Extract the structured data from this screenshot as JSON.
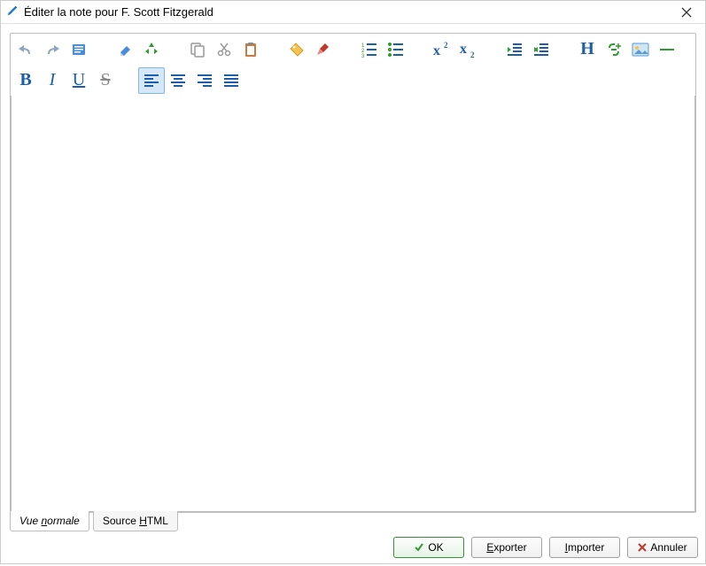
{
  "window": {
    "title": "Éditer la note pour F. Scott Fitzgerald"
  },
  "tabs": {
    "normal": "Vue normale",
    "source_prefix": "Source ",
    "source_underline": "H",
    "source_suffix": "TML"
  },
  "buttons": {
    "ok": "OK",
    "export_underline": "E",
    "export_rest": "xporter",
    "import_underline": "I",
    "import_rest": "mporter",
    "cancel": "Annuler"
  },
  "colors": {
    "blue": "#1d5ea8",
    "green": "#2e9b2e",
    "orange": "#e78b2f",
    "red": "#c0392b",
    "gray": "#888888"
  }
}
